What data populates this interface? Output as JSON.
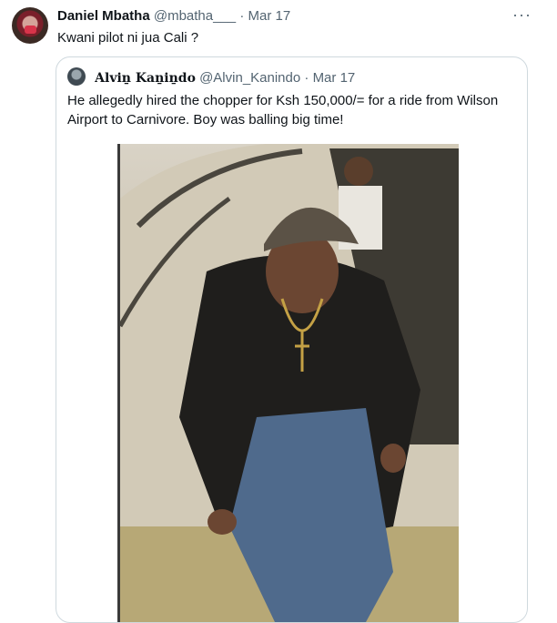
{
  "tweet": {
    "author_name": "Daniel Mbatha",
    "author_handle": "@mbatha___",
    "separator": "·",
    "date": "Mar 17",
    "more_label": "···",
    "text": "Kwani pilot ni jua Cali ?"
  },
  "quote": {
    "author_name": "Alviṉ Kaṉiṉdo",
    "author_handle": "@Alvin_Kanindo",
    "separator": "·",
    "date": "Mar 17",
    "text": "He allegedly hired the chopper for Ksh 150,000/= for a ride from Wilson Airport to Carnivore. Boy was balling big time!"
  },
  "colors": {
    "text": "#0f1419",
    "muted": "#536471",
    "border": "#cfd9de"
  }
}
